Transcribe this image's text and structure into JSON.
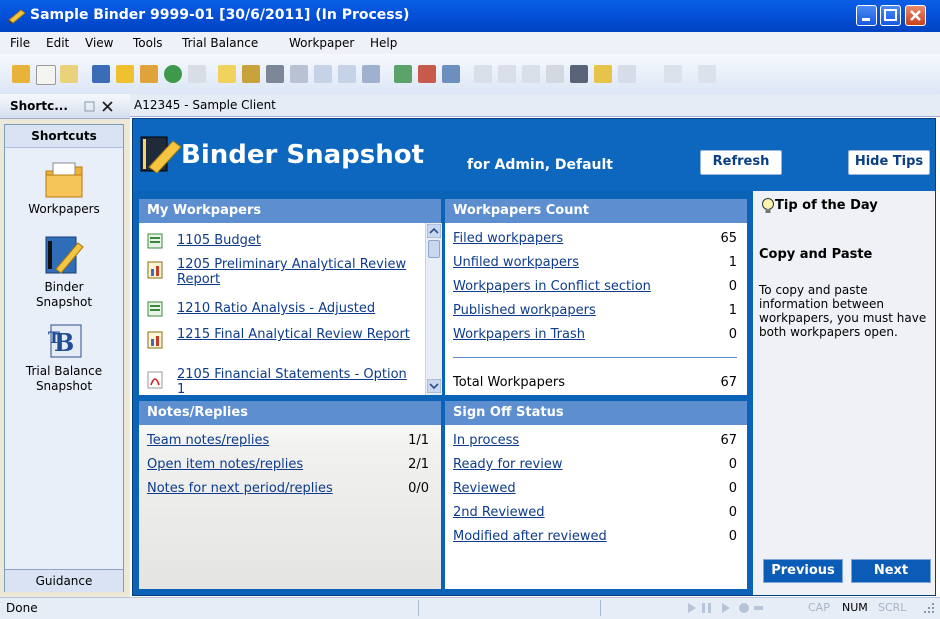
{
  "window": {
    "title": "Sample Binder 9999-01 [30/6/2011] (In Process)"
  },
  "menu": [
    "File",
    "Edit",
    "View",
    "Tools",
    "Trial Balance",
    "Workpaper",
    "Help"
  ],
  "leftpane": {
    "title": "Shortc...",
    "header": "Shortcuts",
    "items": [
      {
        "label": "Workpapers",
        "icon": "folder-icon"
      },
      {
        "label": "Binder Snapshot",
        "icon": "binder-icon"
      },
      {
        "label": "Trial Balance Snapshot",
        "icon": "tb-icon"
      }
    ],
    "footer": "Guidance"
  },
  "main": {
    "tab_label": "A12345 - Sample Client",
    "header": {
      "title": "Binder Snapshot",
      "subtitle": "for Admin, Default",
      "refresh": "Refresh",
      "hide_tips": "Hide Tips"
    },
    "my_workpapers": {
      "title": "My Workpapers",
      "items": [
        {
          "label": "1105 Budget",
          "icon": "spreadsheet-icon"
        },
        {
          "label": "1205 Preliminary Analytical Review Report",
          "icon": "report-icon"
        },
        {
          "label": "1210 Ratio Analysis - Adjusted",
          "icon": "spreadsheet-icon"
        },
        {
          "label": "1215 Final Analytical Review Report",
          "icon": "report-icon"
        },
        {
          "label": "2105 Financial Statements - Option 1",
          "icon": "pdf-icon"
        }
      ]
    },
    "workpapers_count": {
      "title": "Workpapers Count",
      "rows": [
        {
          "label": "Filed workpapers",
          "value": "65"
        },
        {
          "label": "Unfiled workpapers",
          "value": "1"
        },
        {
          "label": "Workpapers in Conflict section",
          "value": "0"
        },
        {
          "label": "Published workpapers",
          "value": "1"
        },
        {
          "label": "Workpapers in Trash",
          "value": "0"
        }
      ],
      "total_label": "Total Workpapers",
      "total_value": "67"
    },
    "notes": {
      "title": "Notes/Replies",
      "rows": [
        {
          "label": "Team notes/replies",
          "value": "1/1"
        },
        {
          "label": "Open item notes/replies",
          "value": "2/1"
        },
        {
          "label": "Notes for next period/replies",
          "value": "0/0"
        }
      ]
    },
    "signoff": {
      "title": "Sign Off Status",
      "rows": [
        {
          "label": "In process",
          "value": "67"
        },
        {
          "label": "Ready for review",
          "value": "0"
        },
        {
          "label": "Reviewed",
          "value": "0"
        },
        {
          "label": "2nd Reviewed",
          "value": "0"
        },
        {
          "label": "Modified after reviewed",
          "value": "0"
        }
      ]
    },
    "tips": {
      "title": "Tip of the Day",
      "heading": "Copy and Paste",
      "body": "To copy and paste information between workpapers, you must have both workpapers open.",
      "previous": "Previous",
      "next": "Next"
    }
  },
  "statusbar": {
    "text": "Done",
    "indicators": [
      "CAP",
      "NUM",
      "SCRL"
    ]
  }
}
